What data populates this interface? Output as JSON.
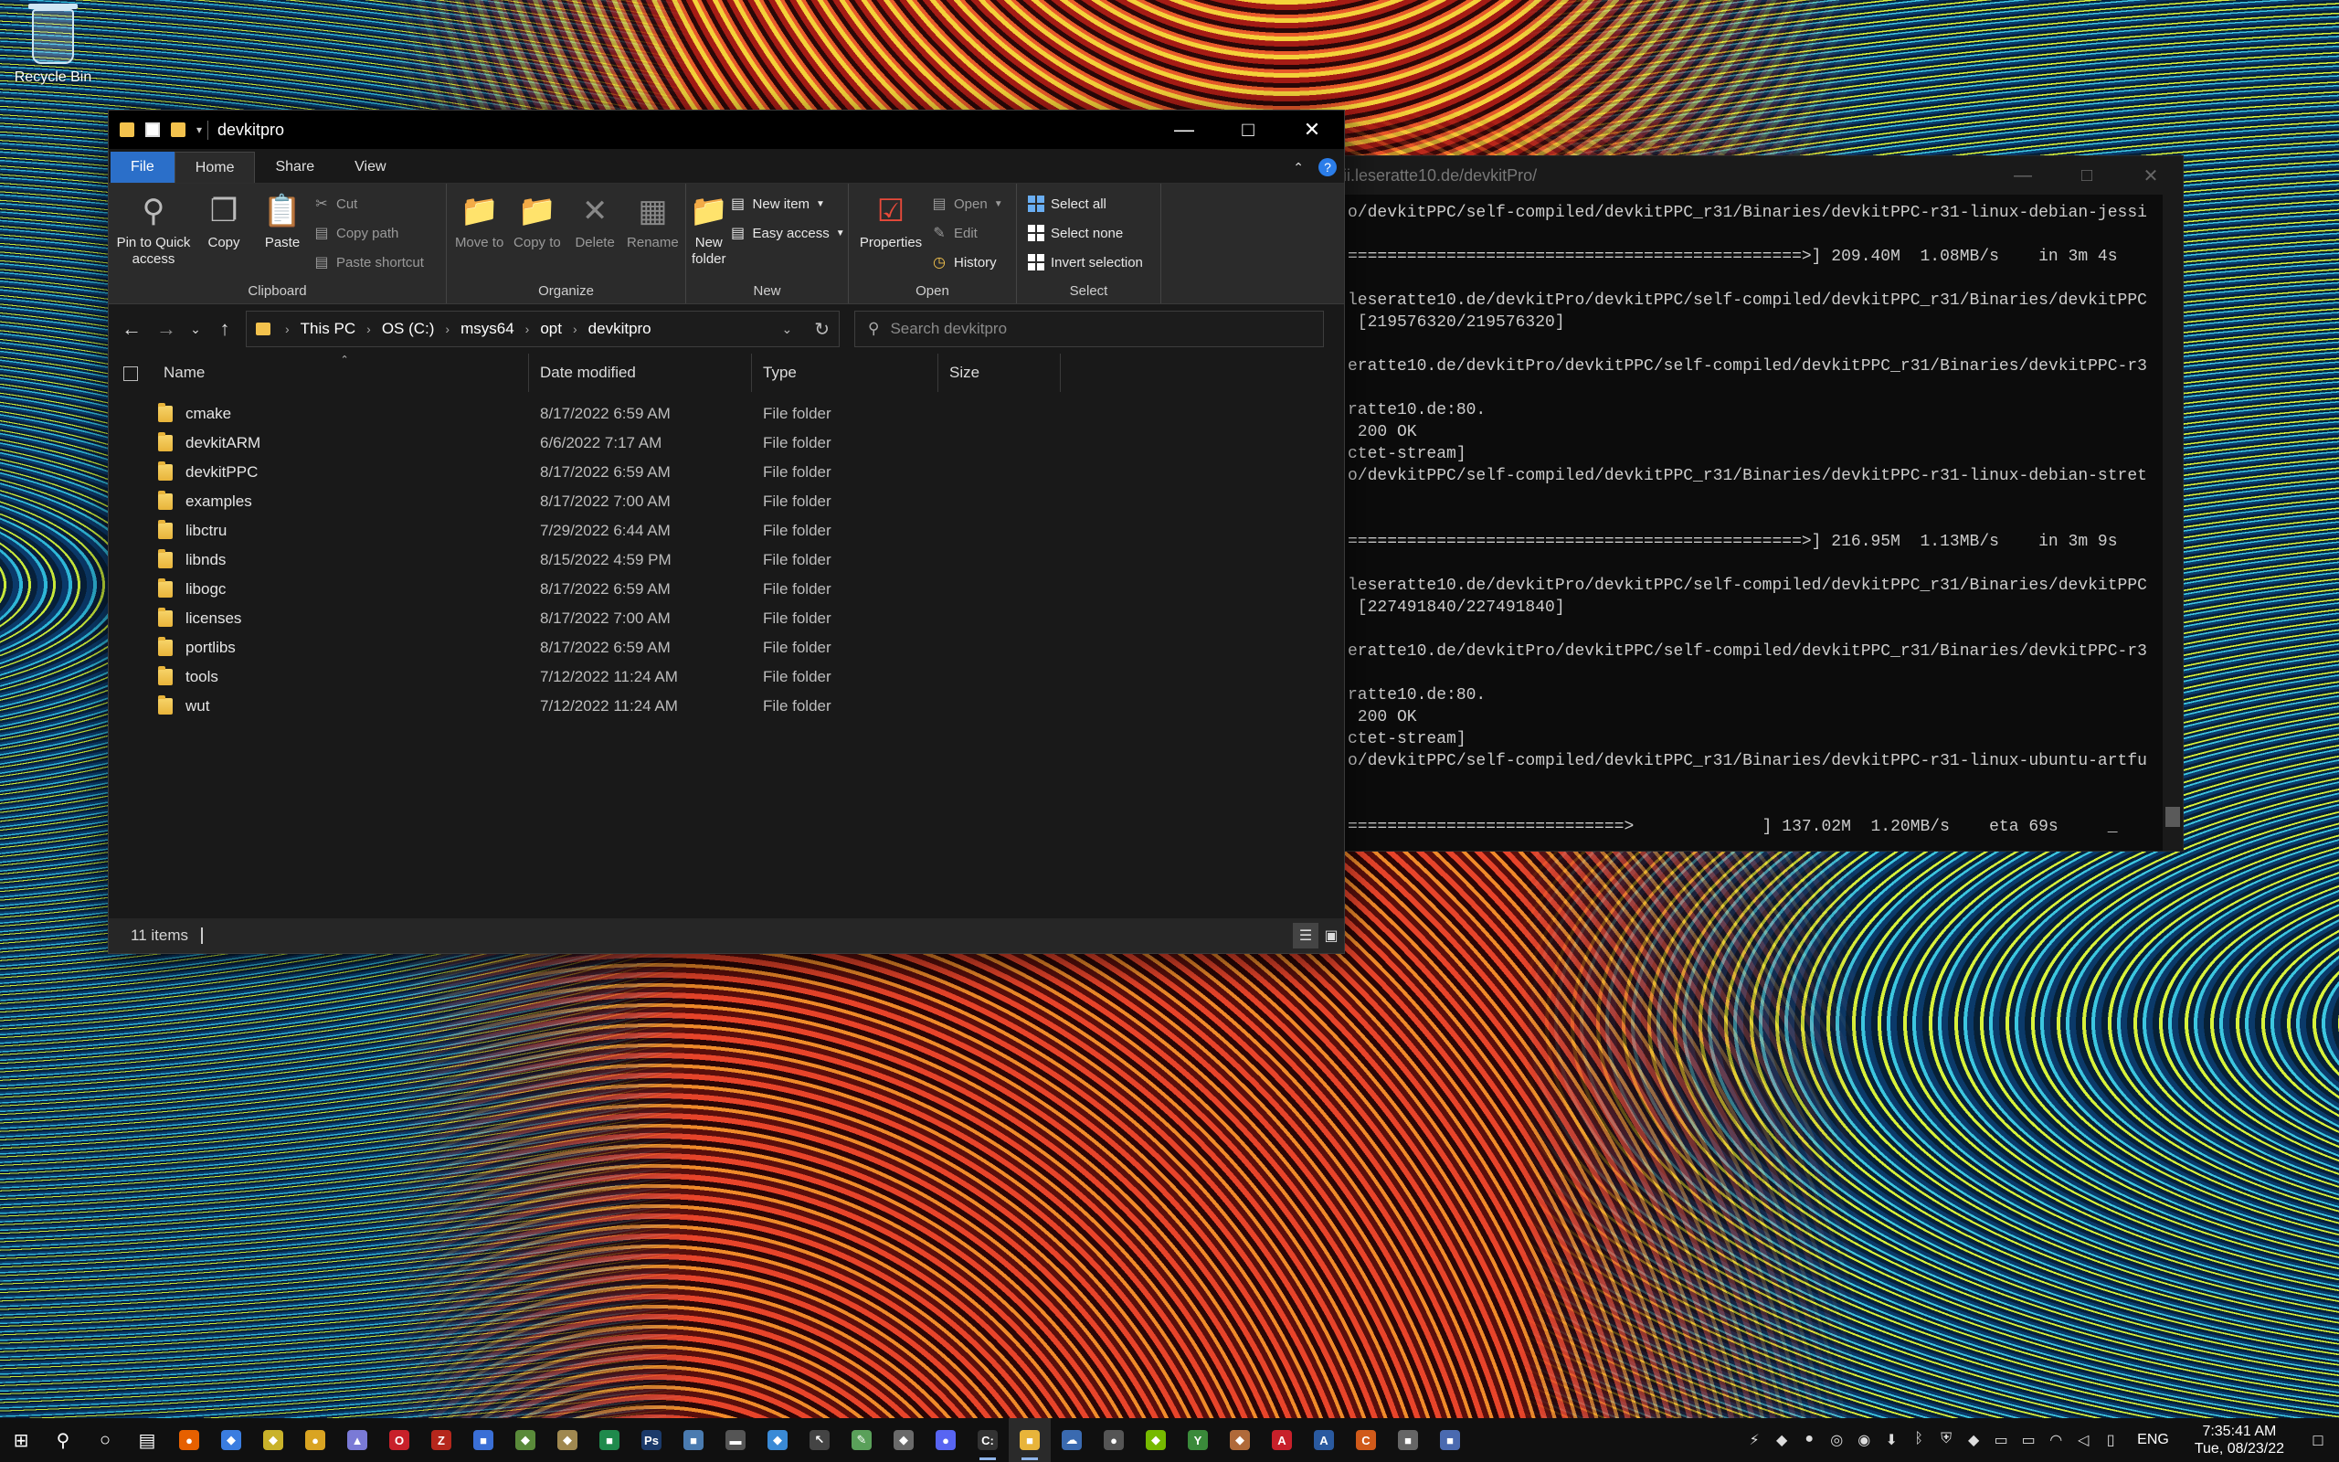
{
  "desktop": {
    "recycle_bin_label": "Recycle Bin"
  },
  "terminal": {
    "title": "wii.leseratte10.de/devkitPro/",
    "lines": [
      "o/devkitPPC/self-compiled/devkitPPC_r31/Binaries/devkitPPC-r31-linux-debian-jessi",
      "",
      "==============================================>] 209.40M  1.08MB/s    in 3m 4s",
      "",
      "leseratte10.de/devkitPro/devkitPPC/self-compiled/devkitPPC_r31/Binaries/devkitPPC",
      " [219576320/219576320]",
      "",
      "eratte10.de/devkitPro/devkitPPC/self-compiled/devkitPPC_r31/Binaries/devkitPPC-r3",
      "",
      "ratte10.de:80.",
      " 200 OK",
      "ctet-stream]",
      "o/devkitPPC/self-compiled/devkitPPC_r31/Binaries/devkitPPC-r31-linux-debian-stret",
      "",
      "",
      "==============================================>] 216.95M  1.13MB/s    in 3m 9s",
      "",
      "leseratte10.de/devkitPro/devkitPPC/self-compiled/devkitPPC_r31/Binaries/devkitPPC",
      " [227491840/227491840]",
      "",
      "eratte10.de/devkitPro/devkitPPC/self-compiled/devkitPPC_r31/Binaries/devkitPPC-r3",
      "",
      "ratte10.de:80.",
      " 200 OK",
      "ctet-stream]",
      "o/devkitPPC/self-compiled/devkitPPC_r31/Binaries/devkitPPC-r31-linux-ubuntu-artfu",
      "",
      "",
      "============================>             ] 137.02M  1.20MB/s    eta 69s     _"
    ]
  },
  "explorer": {
    "title": "devkitpro",
    "tabs": {
      "file": "File",
      "home": "Home",
      "share": "Share",
      "view": "View"
    },
    "ribbon": {
      "clipboard": {
        "label": "Clipboard",
        "pin": "Pin to Quick access",
        "copy": "Copy",
        "paste": "Paste",
        "cut": "Cut",
        "copy_path": "Copy path",
        "paste_shortcut": "Paste shortcut"
      },
      "organize": {
        "label": "Organize",
        "move_to": "Move to",
        "copy_to": "Copy to",
        "delete": "Delete",
        "rename": "Rename"
      },
      "new": {
        "label": "New",
        "new_folder": "New folder",
        "new_item": "New item",
        "easy_access": "Easy access"
      },
      "open": {
        "label": "Open",
        "properties": "Properties",
        "open": "Open",
        "edit": "Edit",
        "history": "History"
      },
      "select": {
        "label": "Select",
        "select_all": "Select all",
        "select_none": "Select none",
        "invert": "Invert selection"
      }
    },
    "breadcrumb": [
      "This PC",
      "OS (C:)",
      "msys64",
      "opt",
      "devkitpro"
    ],
    "search_placeholder": "Search devkitpro",
    "columns": {
      "name": "Name",
      "date": "Date modified",
      "type": "Type",
      "size": "Size"
    },
    "files": [
      {
        "name": "cmake",
        "date": "8/17/2022 6:59 AM",
        "type": "File folder"
      },
      {
        "name": "devkitARM",
        "date": "6/6/2022 7:17 AM",
        "type": "File folder"
      },
      {
        "name": "devkitPPC",
        "date": "8/17/2022 6:59 AM",
        "type": "File folder"
      },
      {
        "name": "examples",
        "date": "8/17/2022 7:00 AM",
        "type": "File folder"
      },
      {
        "name": "libctru",
        "date": "7/29/2022 6:44 AM",
        "type": "File folder"
      },
      {
        "name": "libnds",
        "date": "8/15/2022 4:59 PM",
        "type": "File folder"
      },
      {
        "name": "libogc",
        "date": "8/17/2022 6:59 AM",
        "type": "File folder"
      },
      {
        "name": "licenses",
        "date": "8/17/2022 7:00 AM",
        "type": "File folder"
      },
      {
        "name": "portlibs",
        "date": "8/17/2022 6:59 AM",
        "type": "File folder"
      },
      {
        "name": "tools",
        "date": "7/12/2022 11:24 AM",
        "type": "File folder"
      },
      {
        "name": "wut",
        "date": "7/12/2022 11:24 AM",
        "type": "File folder"
      }
    ],
    "status": "11 items"
  },
  "taskbar": {
    "apps": [
      {
        "name": "firefox-icon",
        "glyph": "●",
        "color": "#e66000"
      },
      {
        "name": "messenger-icon",
        "glyph": "◆",
        "color": "#3b7de0"
      },
      {
        "name": "app-icon",
        "glyph": "◆",
        "color": "#c9b22a"
      },
      {
        "name": "chrome-icon",
        "glyph": "●",
        "color": "#d9a422"
      },
      {
        "name": "rocket-icon",
        "glyph": "▲",
        "color": "#7a7ad6"
      },
      {
        "name": "opera-icon",
        "glyph": "O",
        "color": "#c8202a"
      },
      {
        "name": "filezilla-icon",
        "glyph": "Z",
        "color": "#b5271c"
      },
      {
        "name": "desktop-app-icon",
        "glyph": "■",
        "color": "#3a6fd6"
      },
      {
        "name": "app-icon",
        "glyph": "◆",
        "color": "#5a8a3a"
      },
      {
        "name": "app-icon",
        "glyph": "◆",
        "color": "#a08850"
      },
      {
        "name": "spreadsheet-icon",
        "glyph": "■",
        "color": "#1f8a4c"
      },
      {
        "name": "photoshop-icon",
        "glyph": "Ps",
        "color": "#1b3a6a"
      },
      {
        "name": "app-icon",
        "glyph": "■",
        "color": "#4a7bb0"
      },
      {
        "name": "keyboard-icon",
        "glyph": "▬",
        "color": "#555555"
      },
      {
        "name": "app-icon",
        "glyph": "◆",
        "color": "#3a8ad6"
      },
      {
        "name": "cursor-icon",
        "glyph": "↖",
        "color": "#444444"
      },
      {
        "name": "pen-icon",
        "glyph": "✎",
        "color": "#5aa05a"
      },
      {
        "name": "app-icon",
        "glyph": "◆",
        "color": "#6a6a6a"
      },
      {
        "name": "discord-icon",
        "glyph": "●",
        "color": "#5865f2"
      },
      {
        "name": "terminal-icon",
        "glyph": "C:",
        "color": "#333333"
      },
      {
        "name": "file-explorer-icon",
        "glyph": "■",
        "color": "#e8b43a"
      },
      {
        "name": "cloud-icon",
        "glyph": "☁",
        "color": "#3a6ab0"
      },
      {
        "name": "game-icon",
        "glyph": "●",
        "color": "#555555"
      },
      {
        "name": "nvidia-icon",
        "glyph": "◆",
        "color": "#76b900"
      },
      {
        "name": "app-icon",
        "glyph": "Y",
        "color": "#3a8a3a"
      },
      {
        "name": "app-icon",
        "glyph": "◆",
        "color": "#b06a3a"
      },
      {
        "name": "acrobat-icon",
        "glyph": "A",
        "color": "#c8202a"
      },
      {
        "name": "app-icon",
        "glyph": "A",
        "color": "#2a5aa0"
      },
      {
        "name": "cpuid-icon",
        "glyph": "C",
        "color": "#d05a1a"
      },
      {
        "name": "printer-icon",
        "glyph": "■",
        "color": "#666666"
      },
      {
        "name": "app-icon",
        "glyph": "■",
        "color": "#4a6ab0"
      }
    ],
    "tray": [
      {
        "name": "lightning-icon",
        "glyph": "⚡"
      },
      {
        "name": "app-icon",
        "glyph": "◆"
      },
      {
        "name": "steam-icon",
        "glyph": "●"
      },
      {
        "name": "lifebuoy-icon",
        "glyph": "◎"
      },
      {
        "name": "app-icon",
        "glyph": "◉"
      },
      {
        "name": "download-icon",
        "glyph": "⬇"
      },
      {
        "name": "bluetooth-icon",
        "glyph": "ᛒ"
      },
      {
        "name": "shield-icon",
        "glyph": "⛨"
      },
      {
        "name": "app-icon",
        "glyph": "◆"
      },
      {
        "name": "monitor-icon",
        "glyph": "▭"
      },
      {
        "name": "battery-icon",
        "glyph": "▭"
      },
      {
        "name": "wifi-icon",
        "glyph": "◠"
      },
      {
        "name": "volume-icon",
        "glyph": "◁"
      },
      {
        "name": "usb-icon",
        "glyph": "▯"
      }
    ],
    "language": "ENG",
    "time": "7:35:41 AM",
    "date": "Tue, 08/23/22"
  }
}
